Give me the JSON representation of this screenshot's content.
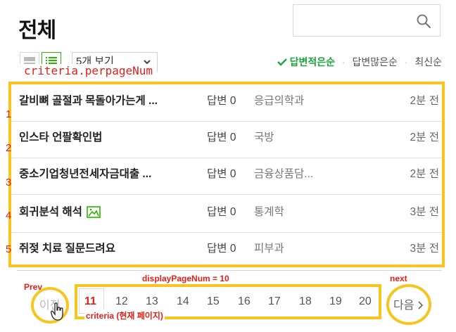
{
  "header": {
    "title": "전체"
  },
  "search": {
    "value": "",
    "placeholder": ""
  },
  "toolbar": {
    "view_modes": [
      "card-view-icon",
      "list-view-icon"
    ],
    "perpage_label": "5개 보기",
    "sort_options": {
      "active": "답변적은순",
      "option2": "답변많은순",
      "option3": "최신순"
    }
  },
  "annotations": {
    "perpage": "criteria.perpageNum",
    "display": "displayPageNum = 10",
    "prev": "Prev",
    "next": "next",
    "criteria": "criteria (현재 페이지)",
    "row_numbers": [
      "1",
      "2",
      "3",
      "4",
      "5"
    ]
  },
  "questions": [
    {
      "title": "갈비뼈 골절과 목돌아가는게 ...",
      "answers": "답변 0",
      "category": "응급의학과",
      "time": "2분 전",
      "has_image": false
    },
    {
      "title": "인스타 언팔확인법",
      "answers": "답변 0",
      "category": "국방",
      "time": "2분 전",
      "has_image": false
    },
    {
      "title": "중소기업청년전세자금대출 ...",
      "answers": "답변 0",
      "category": "금융상품담...",
      "time": "2분 전",
      "has_image": false
    },
    {
      "title": "회귀분석 해석",
      "answers": "답변 0",
      "category": "통계학",
      "time": "3분 전",
      "has_image": true
    },
    {
      "title": "쥐젖 치료 질문드려요",
      "answers": "답변 0",
      "category": "피부과",
      "time": "3분 전",
      "has_image": false
    }
  ],
  "pagination": {
    "prev_label": "이전",
    "next_label": "다음",
    "pages": [
      "11",
      "12",
      "13",
      "14",
      "15",
      "16",
      "17",
      "18",
      "19",
      "20"
    ],
    "current_page": "11"
  },
  "colors": {
    "accent_green": "#1da53a",
    "highlight_yellow": "#f7c51e",
    "annotation_red": "#e0211a"
  }
}
